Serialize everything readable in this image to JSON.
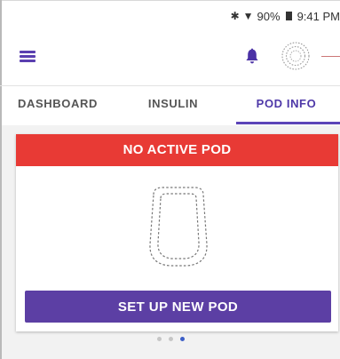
{
  "status_bar": {
    "bluetooth_icon": "bluetooth-icon",
    "wifi_icon": "wifi-icon",
    "battery_percent": "90%",
    "battery_icon": "battery-icon",
    "time": "9:41 PM"
  },
  "header": {
    "menu_icon": "hamburger-menu-icon",
    "bell_icon": "notification-bell-icon",
    "avatar_icon": "dotted-circle-avatar"
  },
  "tabs": [
    {
      "label": "DASHBOARD",
      "active": false
    },
    {
      "label": "INSULIN",
      "active": false
    },
    {
      "label": "POD INFO",
      "active": true
    }
  ],
  "pod_card": {
    "alert": "NO ACTIVE POD",
    "pod_icon": "pod-outline-icon",
    "button_label": "SET UP NEW POD"
  },
  "pagination": {
    "total": 3,
    "active_index": 2
  },
  "colors": {
    "alert_red": "#e83a35",
    "primary_purple": "#5c3fa4",
    "active_tab": "#4e38a8",
    "active_dot": "#3d5fc7"
  }
}
